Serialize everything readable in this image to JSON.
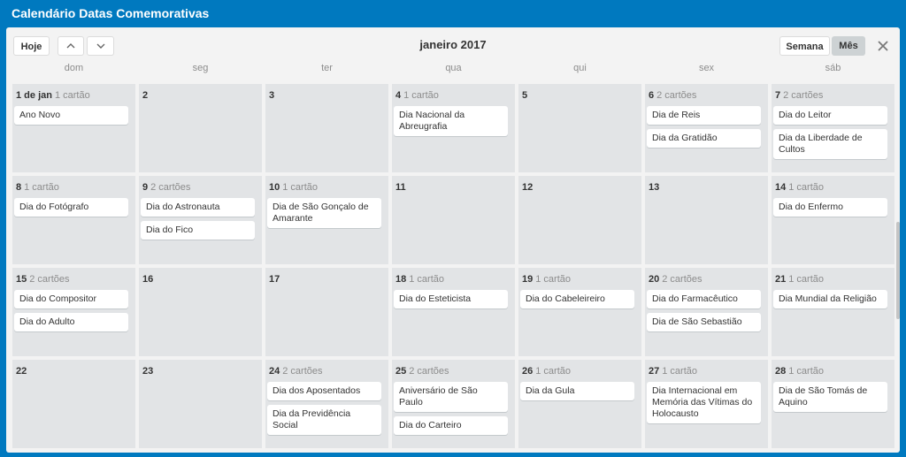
{
  "header": {
    "title": "Calendário Datas Comemorativas"
  },
  "toolbar": {
    "today_label": "Hoje",
    "month_title": "janeiro 2017",
    "week_label": "Semana",
    "month_label": "Mês"
  },
  "weekdays": [
    "dom",
    "seg",
    "ter",
    "qua",
    "qui",
    "sex",
    "sáb"
  ],
  "weeks": [
    [
      {
        "day": "1 de jan",
        "count": "1 cartão",
        "cards": [
          "Ano Novo"
        ]
      },
      {
        "day": "2",
        "count": "",
        "cards": []
      },
      {
        "day": "3",
        "count": "",
        "cards": []
      },
      {
        "day": "4",
        "count": "1 cartão",
        "cards": [
          "Dia Nacional da Abreugrafia"
        ]
      },
      {
        "day": "5",
        "count": "",
        "cards": []
      },
      {
        "day": "6",
        "count": "2 cartões",
        "cards": [
          "Dia de Reis",
          "Dia da Gratidão"
        ]
      },
      {
        "day": "7",
        "count": "2 cartões",
        "cards": [
          "Dia do Leitor",
          "Dia da Liberdade de Cultos"
        ]
      }
    ],
    [
      {
        "day": "8",
        "count": "1 cartão",
        "cards": [
          "Dia do Fotógrafo"
        ]
      },
      {
        "day": "9",
        "count": "2 cartões",
        "cards": [
          "Dia do Astronauta",
          "Dia do Fico"
        ]
      },
      {
        "day": "10",
        "count": "1 cartão",
        "cards": [
          "Dia de São Gonçalo de Amarante"
        ]
      },
      {
        "day": "11",
        "count": "",
        "cards": []
      },
      {
        "day": "12",
        "count": "",
        "cards": []
      },
      {
        "day": "13",
        "count": "",
        "cards": []
      },
      {
        "day": "14",
        "count": "1 cartão",
        "cards": [
          "Dia do Enfermo"
        ]
      }
    ],
    [
      {
        "day": "15",
        "count": "2 cartões",
        "cards": [
          "Dia do Compositor",
          "Dia do Adulto"
        ]
      },
      {
        "day": "16",
        "count": "",
        "cards": []
      },
      {
        "day": "17",
        "count": "",
        "cards": []
      },
      {
        "day": "18",
        "count": "1 cartão",
        "cards": [
          "Dia do Esteticista"
        ]
      },
      {
        "day": "19",
        "count": "1 cartão",
        "cards": [
          "Dia do Cabeleireiro"
        ]
      },
      {
        "day": "20",
        "count": "2 cartões",
        "cards": [
          "Dia do Farmacêutico",
          "Dia de São Sebastião"
        ]
      },
      {
        "day": "21",
        "count": "1 cartão",
        "cards": [
          "Dia Mundial da Religião"
        ]
      }
    ],
    [
      {
        "day": "22",
        "count": "",
        "cards": []
      },
      {
        "day": "23",
        "count": "",
        "cards": []
      },
      {
        "day": "24",
        "count": "2 cartões",
        "cards": [
          "Dia dos Aposentados",
          "Dia da Previdência Social"
        ]
      },
      {
        "day": "25",
        "count": "2 cartões",
        "cards": [
          "Aniversário de São Paulo",
          "Dia do Carteiro"
        ]
      },
      {
        "day": "26",
        "count": "1 cartão",
        "cards": [
          "Dia da Gula"
        ]
      },
      {
        "day": "27",
        "count": "1 cartão",
        "cards": [
          "Dia Internacional em Memória das Vítimas do Holocausto"
        ]
      },
      {
        "day": "28",
        "count": "1 cartão",
        "cards": [
          "Dia de São Tomás de Aquino"
        ]
      }
    ]
  ]
}
